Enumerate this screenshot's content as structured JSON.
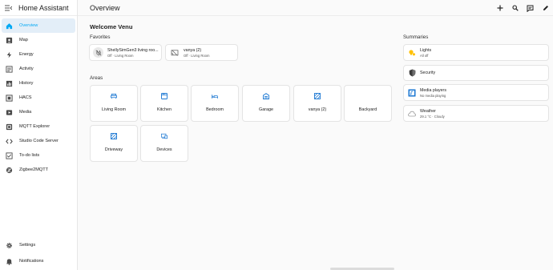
{
  "app": {
    "title": "Home Assistant"
  },
  "topbar": {
    "title": "Overview"
  },
  "sidebar": {
    "items": [
      {
        "label": "Overview",
        "icon": "overview-icon",
        "active": true
      },
      {
        "label": "Map",
        "icon": "map-icon"
      },
      {
        "label": "Energy",
        "icon": "energy-icon"
      },
      {
        "label": "Activity",
        "icon": "activity-icon"
      },
      {
        "label": "History",
        "icon": "history-icon"
      },
      {
        "label": "HACS",
        "icon": "hacs-icon"
      },
      {
        "label": "Media",
        "icon": "media-icon"
      },
      {
        "label": "MQTT Explorer",
        "icon": "mqtt-icon"
      },
      {
        "label": "Studio Code Server",
        "icon": "code-server-icon"
      },
      {
        "label": "To-do lists",
        "icon": "todo-icon"
      },
      {
        "label": "Zigbee2MQTT",
        "icon": "zigbee-icon"
      }
    ],
    "bottom": [
      {
        "label": "Settings",
        "icon": "gear-icon"
      },
      {
        "label": "Notifications",
        "icon": "bell-icon"
      }
    ]
  },
  "main": {
    "welcome": "Welcome Venu",
    "favorites_title": "Favorites",
    "favorites": [
      {
        "name": "ShellySimGen3 living roo...",
        "sub": "Off · Living Room"
      },
      {
        "name": "vanya (2)",
        "sub": "Off · Living Room"
      }
    ],
    "areas_title": "Areas",
    "areas": [
      {
        "label": "Living Room",
        "icon": "sofa-icon"
      },
      {
        "label": "Kitchen",
        "icon": "stove-icon"
      },
      {
        "label": "Bedroom",
        "icon": "bed-icon"
      },
      {
        "label": "Garage",
        "icon": "garage-icon"
      },
      {
        "label": "vanya (2)",
        "icon": "hatched-square-icon"
      },
      {
        "label": "Backyard",
        "icon": ""
      },
      {
        "label": "Driveway",
        "icon": "hatched-square-icon"
      },
      {
        "label": "Devices",
        "icon": "devices-icon"
      }
    ],
    "summaries_title": "Summaries",
    "summaries": [
      {
        "name": "Lights",
        "sub": "All off",
        "icon": "lights-icon"
      },
      {
        "name": "Security",
        "sub": "",
        "icon": "shield-icon"
      },
      {
        "name": "Media players",
        "sub": "No media playing",
        "icon": "media-player-icon"
      },
      {
        "name": "Weather",
        "sub": "29.1 °C · Cloudy",
        "icon": "cloud-icon"
      }
    ]
  },
  "colors": {
    "accent": "#03a9f4",
    "icon_blue": "#1976d2",
    "lights_yellow": "#ffc107"
  }
}
